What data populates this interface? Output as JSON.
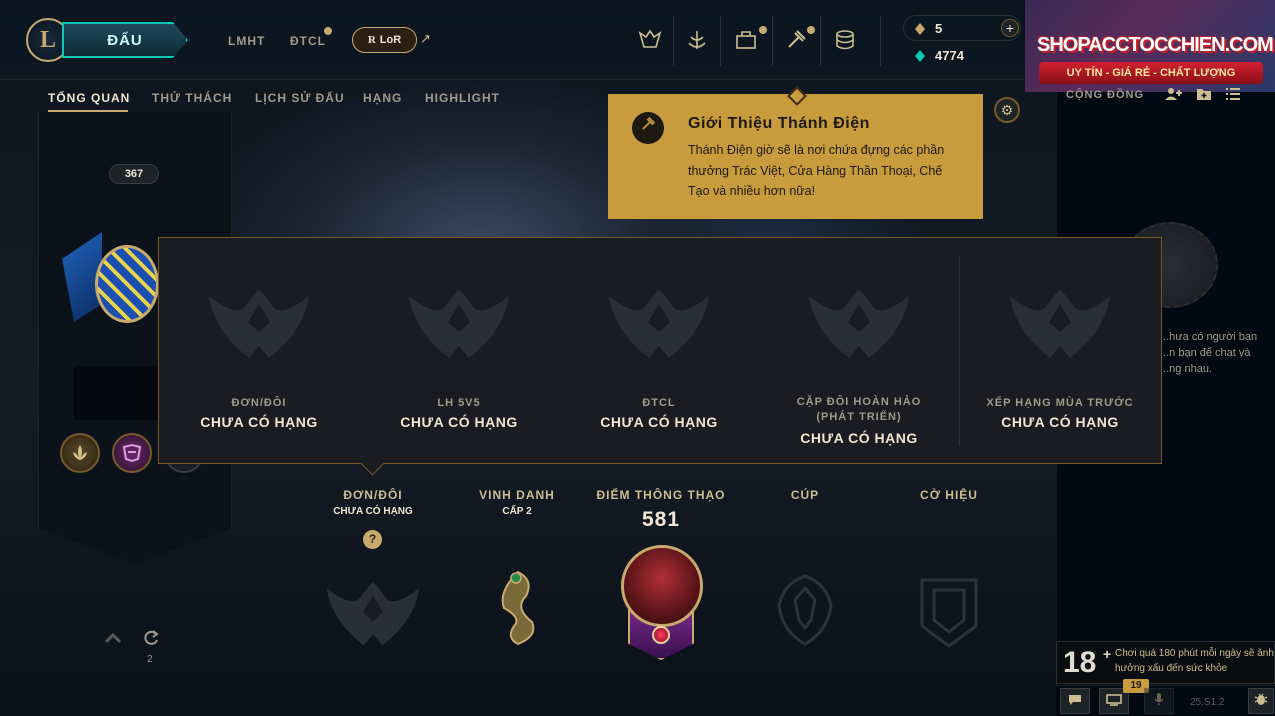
{
  "top_nav": {
    "play_label": "ĐẤU",
    "links": [
      "LMHT",
      "ĐTCL"
    ],
    "lor_label": "LoR",
    "lor_logo": "R",
    "lor_external_icon": "↗"
  },
  "currency": {
    "orange_essence": "5",
    "blue_essence": "4774",
    "add_label": "+"
  },
  "watermark": {
    "title": "SHOPACCTOCCHIEN.COM",
    "subtitle": "UY TÍN - GIÁ RẺ - CHẤT LƯỢNG"
  },
  "sub_nav": {
    "tabs": [
      "TỔNG QUAN",
      "THỬ THÁCH",
      "LỊCH SỬ ĐẤU",
      "HẠNG",
      "HIGHLIGHT"
    ],
    "social_label": "CỘNG ĐỒNG"
  },
  "profile": {
    "level": "367",
    "reroll_count": "2"
  },
  "rank_popup": {
    "queues": [
      {
        "name": "ĐƠN/ĐÔI",
        "rank": "CHƯA CÓ HẠNG"
      },
      {
        "name": "LH 5V5",
        "rank": "CHƯA CÓ HẠNG"
      },
      {
        "name": "ĐTCL",
        "rank": "CHƯA CÓ HẠNG"
      },
      {
        "name": "CẶP ĐÔI HOÀN HẢO (PHÁT TRIỂN)",
        "rank": "CHƯA CÓ HẠNG"
      },
      {
        "name": "XẾP HẠNG MÙA TRƯỚC",
        "rank": "CHƯA CÓ HẠNG"
      }
    ]
  },
  "tooltip": {
    "title": "Giới Thiệu Thánh Điện",
    "body": "Thánh Điện giờ sẽ là nơi chứa đựng các phần thưởng Trác Việt, Cửa Hàng Thần Thoại, Chế Tạo và nhiều hơn nữa!"
  },
  "stats": {
    "ranked_label": "ĐƠN/ĐÔI",
    "ranked_sub": "CHƯA CÓ HẠNG",
    "help_label": "?",
    "honor_label": "VINH DANH",
    "honor_sub": "CẤP 2",
    "mastery_label": "ĐIỂM THÔNG THẠO",
    "mastery_value": "581",
    "trophy_label": "CÚP",
    "banner_label": "CỜ HIỆU"
  },
  "social": {
    "empty_text": "...hưa có người bạn ...n bạn để chat và ...ng nhau."
  },
  "age_warning": {
    "rating": "18",
    "plus": "+",
    "text": "Chơi quá 180 phút mỗi ngày sẽ ảnh hưởng xấu đến sức khỏe"
  },
  "footer": {
    "notification_count": "19",
    "version": "25.S1.2"
  },
  "colors": {
    "gold": "#c8aa6e",
    "teal": "#0ac8b9",
    "tooltip_bg": "#c89b3c",
    "background": "#010a13"
  }
}
